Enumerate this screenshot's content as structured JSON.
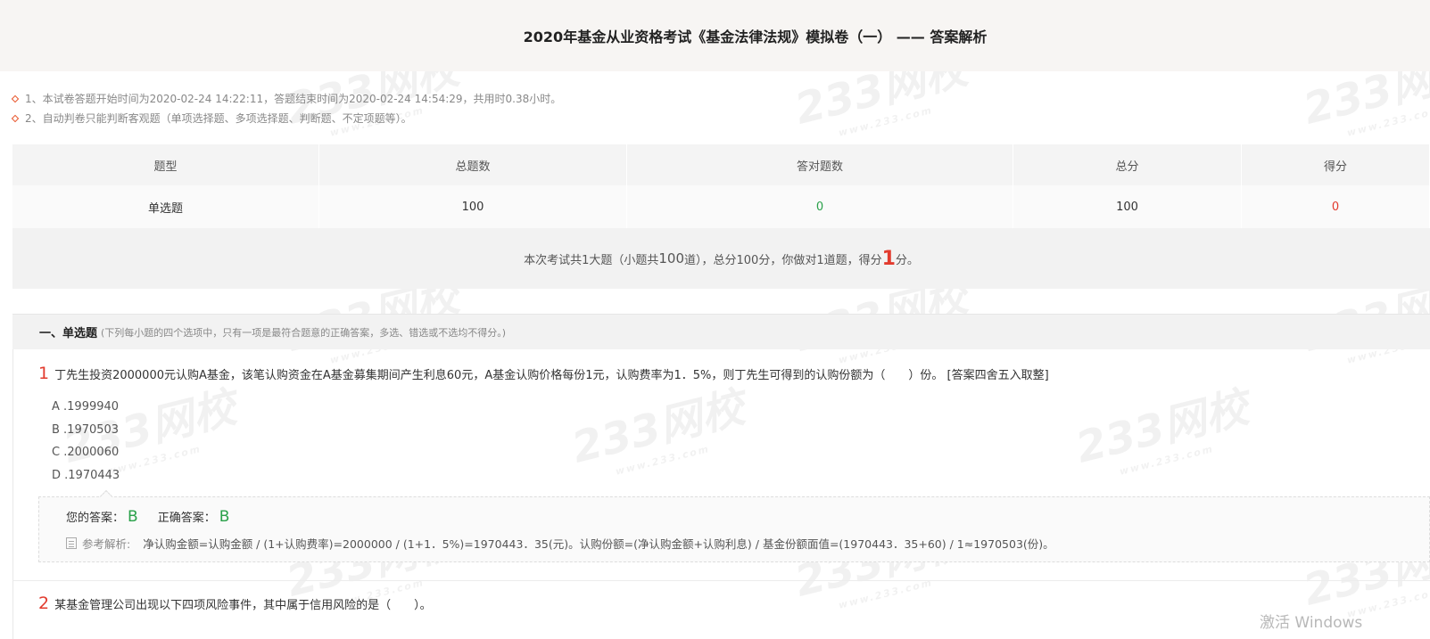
{
  "header": {
    "title": "2020年基金从业资格考试《基金法律法规》模拟卷（一） —— 答案解析"
  },
  "notes": [
    "1、本试卷答题开始时间为2020-02-24 14:22:11，答题结束时间为2020-02-24 14:54:29，共用时0.38小时。",
    "2、自动判卷只能判断客观题（单项选择题、多项选择题、判断题、不定项题等）。"
  ],
  "summary": {
    "headers": [
      "题型",
      "总题数",
      "答对题数",
      "总分",
      "得分"
    ],
    "row": {
      "type": "单选题",
      "total": "100",
      "correct": "0",
      "total_score": "100",
      "score": "0"
    },
    "line": {
      "pre": "本次考试共1大题（小题共",
      "count": "100",
      "mid": "道），总分100分，你做对1道题，得分",
      "score": "1",
      "post": "分。"
    }
  },
  "section": {
    "title": "一、单选题",
    "desc": "(下列每小题的四个选项中，只有一项是最符合题意的正确答案，多选、错选或不选均不得分。)"
  },
  "questions": [
    {
      "number": "1",
      "text": "丁先生投资2000000元认购A基金，该笔认购资金在A基金募集期间产生利息60元，A基金认购价格每份1元，认购费率为1．5%，则丁先生可得到的认购份额为（　　）份。 [答案四舍五入取整]",
      "options": [
        "A .1999940",
        "B .1970503",
        "C .2000060",
        "D .1970443"
      ],
      "your_answer_label": "您的答案：",
      "your_answer": "B",
      "correct_answer_label": "正确答案：",
      "correct_answer": "B",
      "explain_label": "参考解析:",
      "explain": "净认购金额=认购金额 / (1+认购费率)=2000000 / (1+1．5%)=1970443．35(元)。认购份额=(净认购金额+认购利息) / 基金份额面值=(1970443．35+60) / 1≈1970503(份)。"
    },
    {
      "number": "2",
      "text": "某基金管理公司出现以下四项风险事件，其中属于信用风险的是（　　）。"
    }
  ],
  "watermark": {
    "brand": "233网校",
    "url": "www.233.com"
  },
  "windows_activation": "激活 Windows",
  "colors": {
    "accent_red": "#e23b2e",
    "accent_green": "#2aa14a",
    "note_bullet": "#e8542a"
  }
}
